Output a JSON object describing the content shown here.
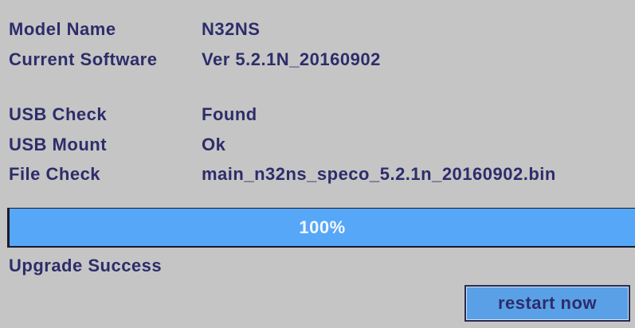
{
  "info": {
    "model_name_label": "Model Name",
    "model_name_value": "N32NS",
    "current_software_label": "Current Software",
    "current_software_value": "Ver 5.2.1N_20160902",
    "usb_check_label": "USB Check",
    "usb_check_value": "Found",
    "usb_mount_label": "USB Mount",
    "usb_mount_value": "Ok",
    "file_check_label": "File Check",
    "file_check_value": "main_n32ns_speco_5.2.1n_20160902.bin"
  },
  "progress": {
    "percent": 100,
    "text": "100%"
  },
  "status": {
    "message": "Upgrade Success"
  },
  "actions": {
    "restart_label": "restart now"
  },
  "colors": {
    "background": "#c5c5c5",
    "text": "#2d2d6b",
    "progress_fill": "#56a7f8",
    "button_fill": "#5aa0e6"
  }
}
